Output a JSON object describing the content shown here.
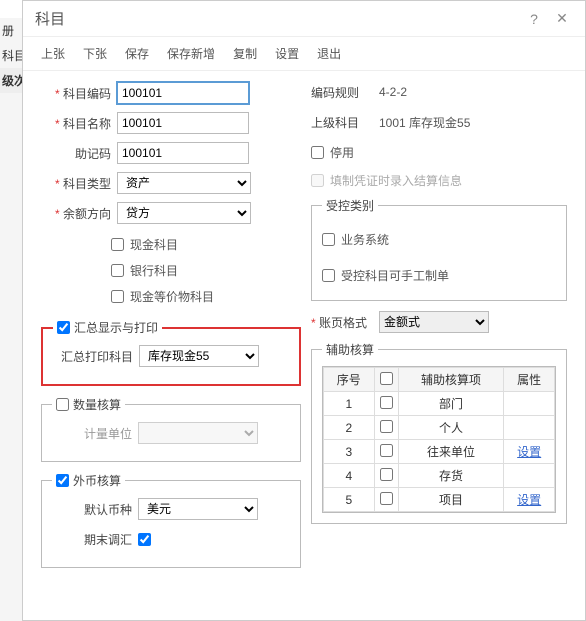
{
  "sidebar": {
    "row1": "册",
    "row2": "科目",
    "row3": "级次"
  },
  "dialog": {
    "title": "科目"
  },
  "toolbar": {
    "prev": "上张",
    "next": "下张",
    "save": "保存",
    "save_new": "保存新增",
    "copy": "复制",
    "settings": "设置",
    "exit": "退出"
  },
  "left": {
    "code_label": "科目编码",
    "code_value": "100101",
    "name_label": "科目名称",
    "name_value": "100101",
    "mnemonic_label": "助记码",
    "mnemonic_value": "100101",
    "type_label": "科目类型",
    "type_value": "资产",
    "balance_label": "余额方向",
    "balance_value": "贷方",
    "cash_label": "现金科目",
    "bank_label": "银行科目",
    "cash_equiv_label": "现金等价物科目",
    "summary_group": "汇总显示与打印",
    "summary_print_label": "汇总打印科目",
    "summary_print_value": "库存现金55",
    "qty_group": "数量核算",
    "unit_label": "计量单位",
    "fx_group": "外币核算",
    "default_currency_label": "默认币种",
    "default_currency_value": "美元",
    "end_adj_label": "期末调汇"
  },
  "right": {
    "code_rule_label": "编码规则",
    "code_rule_value": "4-2-2",
    "parent_label": "上级科目",
    "parent_value": "1001 库存现金55",
    "disable_label": "停用",
    "fill_info_label": "填制凭证时录入结算信息",
    "controlled_group": "受控类别",
    "biz_system_label": "业务系统",
    "manual_label": "受控科目可手工制单",
    "page_format_label": "账页格式",
    "page_format_value": "金额式",
    "aux_group": "辅助核算",
    "table": {
      "h_seq": "序号",
      "h_item": "辅助核算项",
      "h_attr": "属性",
      "rows": [
        {
          "seq": "1",
          "item": "部门",
          "attr": ""
        },
        {
          "seq": "2",
          "item": "个人",
          "attr": ""
        },
        {
          "seq": "3",
          "item": "往来单位",
          "attr": "设置"
        },
        {
          "seq": "4",
          "item": "存货",
          "attr": ""
        },
        {
          "seq": "5",
          "item": "项目",
          "attr": "设置"
        }
      ]
    }
  }
}
